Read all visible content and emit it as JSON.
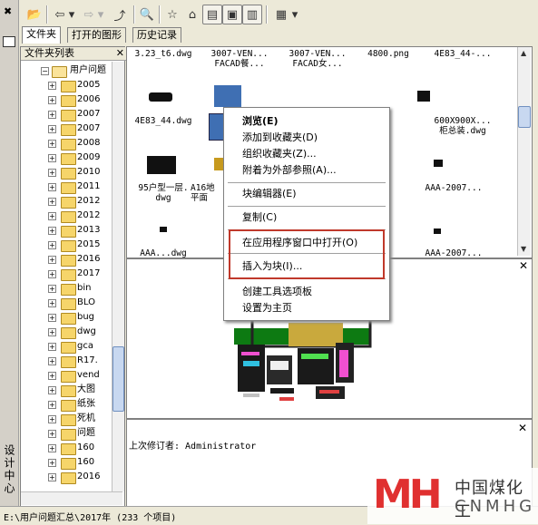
{
  "window": {
    "vertical_title": "设计中心",
    "close_glyph": "✖"
  },
  "toolbar": {
    "icons": [
      "load-icon",
      "back-icon",
      "back-dropdown-icon",
      "forward-icon",
      "forward-dropdown-icon",
      "up-icon",
      "search-icon",
      "favorites-icon",
      "home-icon",
      "tree-toggle-icon",
      "preview-toggle-icon",
      "description-toggle-icon",
      "views-icon",
      "views-dropdown-icon"
    ]
  },
  "tabs": [
    "文件夹",
    "打开的图形",
    "历史记录"
  ],
  "tree": {
    "header": "文件夹列表",
    "root": "用户问题",
    "items": [
      "2005",
      "2006",
      "2007",
      "2007",
      "2008",
      "2009",
      "2010",
      "2011",
      "2012",
      "2012",
      "2013",
      "2015",
      "2016",
      "2017",
      "bin",
      "BLO",
      "bug",
      "dwg",
      "gca",
      "R17.",
      "vend",
      "大图",
      "纸张",
      "死机",
      "问题",
      "160",
      "160",
      "2016"
    ]
  },
  "thumbnails": {
    "row0_labels": [
      "3.23_t6.dwg",
      "3007-VEN...\nFACAD餐...",
      "3007-VEN...\nFACAD女...",
      "4800.png",
      "4E83_44-..."
    ],
    "row1_labels": [
      "4E83_44.dwg",
      "",
      "",
      "",
      "600X900X...\n柜总装.dwg"
    ],
    "row2_labels": [
      "95户型一层.\ndwg",
      "A16地\n平面",
      "",
      "",
      "AAA-2007..."
    ],
    "row3_labels": [
      "AAA...dwg",
      "",
      "",
      "",
      "AAA-2007..."
    ]
  },
  "context_menu": {
    "items": [
      {
        "label": "浏览(E)",
        "bold": true
      },
      {
        "label": "添加到收藏夹(D)"
      },
      {
        "label": "组织收藏夹(Z)..."
      },
      {
        "label": "附着为外部参照(A)..."
      },
      {
        "label": "块编辑器(E)"
      },
      {
        "label": "复制(C)"
      },
      {
        "label": "在应用程序窗口中打开(O)"
      },
      {
        "label": "插入为块(I)..."
      },
      {
        "label": "创建工具选项板"
      },
      {
        "label": "设置为主页"
      }
    ]
  },
  "description": {
    "text": "上次修订者: Administrator"
  },
  "status": {
    "text": "E:\\用户问题汇总\\2017年 (233 个项目)"
  },
  "watermark": {
    "mark": "MH",
    "name_cn": "中国煤化工",
    "name_en": "CNMHG"
  }
}
